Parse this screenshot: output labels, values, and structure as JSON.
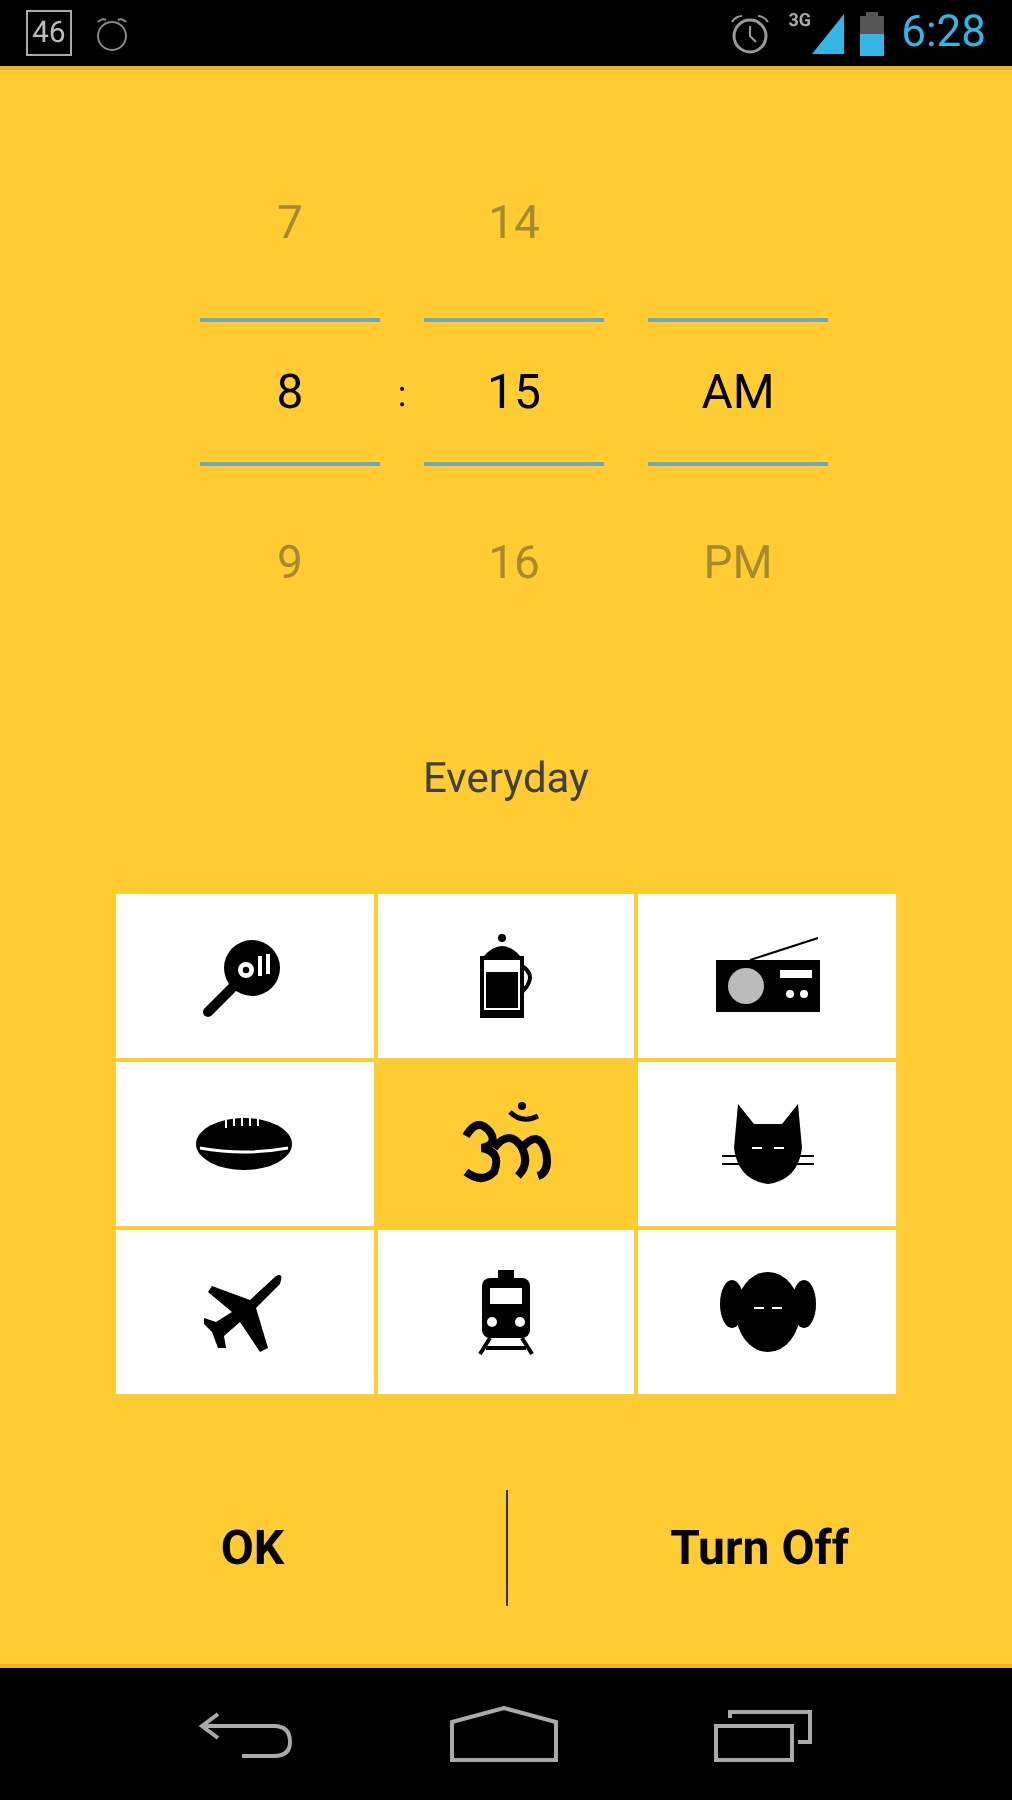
{
  "status_bar": {
    "notification_count": "46",
    "network": "3G",
    "time": "6:28"
  },
  "time_picker": {
    "columns": [
      {
        "above": "7",
        "value": "8",
        "below": "9"
      },
      {
        "above": "14",
        "value": "15",
        "below": "16"
      },
      {
        "value": "AM",
        "below": "PM"
      }
    ],
    "separator": ":"
  },
  "repeat_label": "Everyday",
  "tiles": [
    {
      "kind": "pan",
      "selected": false
    },
    {
      "kind": "press",
      "selected": false
    },
    {
      "kind": "radio",
      "selected": false
    },
    {
      "kind": "football",
      "selected": false
    },
    {
      "kind": "om",
      "selected": true
    },
    {
      "kind": "cat",
      "selected": false
    },
    {
      "kind": "plane",
      "selected": false
    },
    {
      "kind": "train",
      "selected": false
    },
    {
      "kind": "dog",
      "selected": false
    }
  ],
  "buttons": [
    "OK",
    "Turn Off"
  ]
}
